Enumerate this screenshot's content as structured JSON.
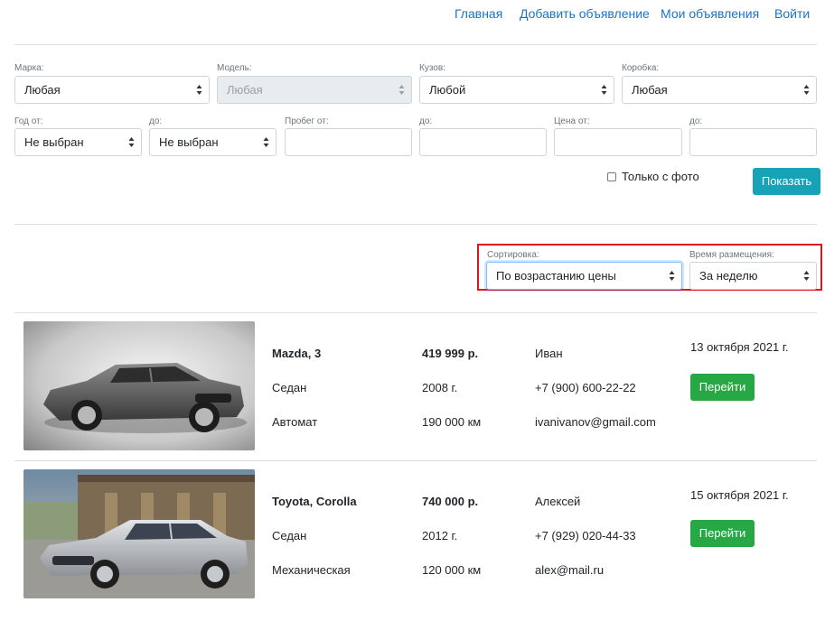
{
  "nav": {
    "home": "Главная",
    "add": "Добавить объявление",
    "my": "Мои объявления",
    "login": "Войти"
  },
  "filters": {
    "brand": {
      "label": "Марка:",
      "value": "Любая"
    },
    "model": {
      "label": "Модель:",
      "value": "Любая"
    },
    "body": {
      "label": "Кузов:",
      "value": "Любой"
    },
    "gearbox": {
      "label": "Коробка:",
      "value": "Любая"
    },
    "year_from": {
      "label": "Год от:",
      "value": "Не выбран"
    },
    "year_to": {
      "label": "до:",
      "value": "Не выбран"
    },
    "mileage_from": {
      "label": "Пробег от:",
      "value": ""
    },
    "mileage_to": {
      "label": "до:",
      "value": ""
    },
    "price_from": {
      "label": "Цена от:",
      "value": ""
    },
    "price_to": {
      "label": "до:",
      "value": ""
    },
    "photo_only_label": "Только с фото",
    "photo_only_checked": false,
    "show_button": "Показать"
  },
  "sort": {
    "sort_label": "Сортировка:",
    "sort_value": "По возрастанию цены",
    "time_label": "Время размещения:",
    "time_value": "За неделю"
  },
  "listings": [
    {
      "title": "Mazda, 3",
      "price": "419 999 р.",
      "seller": "Иван",
      "date": "13 октября 2021 г.",
      "body": "Седан",
      "year": "2008 г.",
      "phone": "+7 (900) 600-22-22",
      "transmission": "Автомат",
      "mileage": "190 000 км",
      "email": "ivanivanov@gmail.com",
      "go_button": "Перейти"
    },
    {
      "title": "Toyota, Corolla",
      "price": "740 000 р.",
      "seller": "Алексей",
      "date": "15 октября 2021 г.",
      "body": "Седан",
      "year": "2012 г.",
      "phone": "+7 (929) 020-44-33",
      "transmission": "Механическая",
      "mileage": "120 000 км",
      "email": "alex@mail.ru",
      "go_button": "Перейти"
    }
  ],
  "colors": {
    "link": "#1a73c8",
    "show_button": "#17a2b8",
    "go_button": "#28a745",
    "highlight": "#e0141e"
  }
}
